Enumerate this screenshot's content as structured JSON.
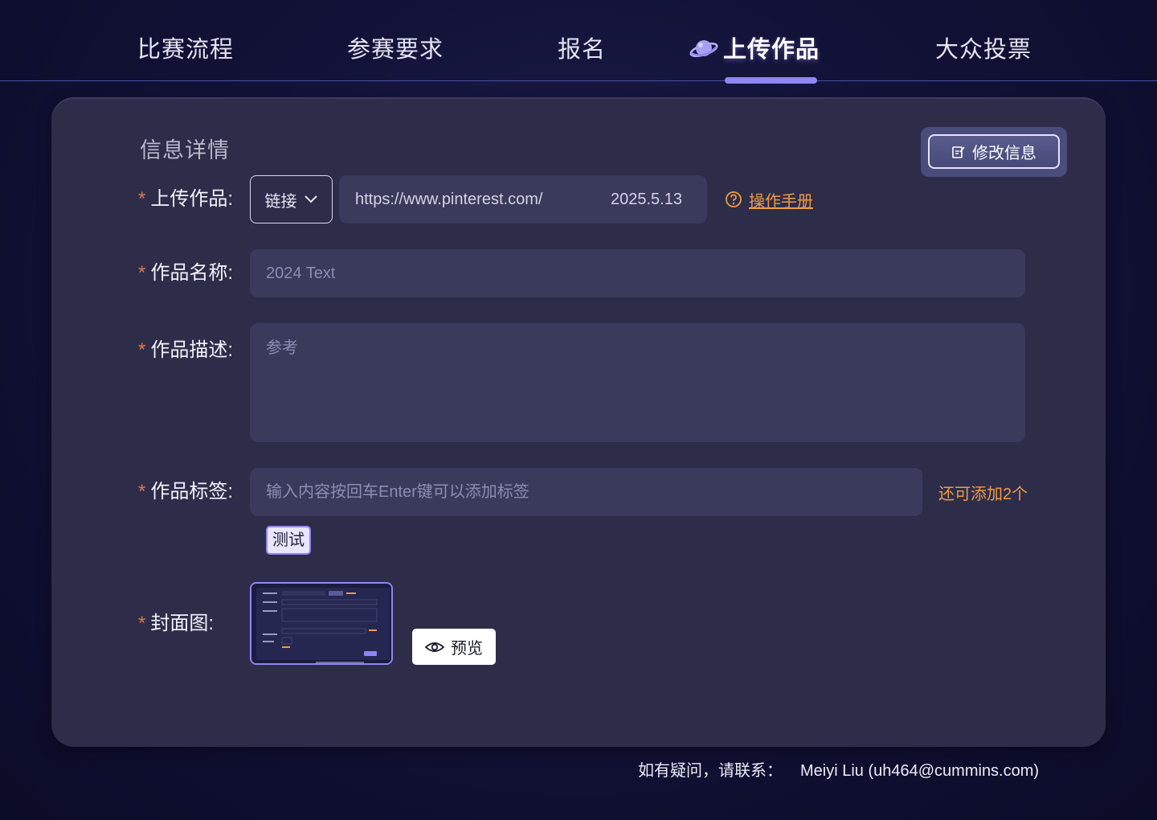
{
  "nav": {
    "tabs": [
      {
        "label": "比赛流程"
      },
      {
        "label": "参赛要求"
      },
      {
        "label": "报名"
      },
      {
        "label": "上传作品",
        "active": true,
        "icon": "planet-icon"
      },
      {
        "label": "大众投票"
      }
    ],
    "accent_color": "#8f86f3"
  },
  "form": {
    "section_title": "信息详情",
    "edit_button": {
      "label": "修改信息",
      "icon": "edit-icon"
    },
    "upload": {
      "label": "上传作品:",
      "type_select": "链接",
      "url_value": "https://www.pinterest.com/",
      "date_value": "2025.5.13",
      "manual_link": "操作手册",
      "manual_icon": "question-circle-icon"
    },
    "name": {
      "label": "作品名称:",
      "placeholder": "2024 Text"
    },
    "description": {
      "label": "作品描述:",
      "placeholder": "参考"
    },
    "tags": {
      "label": "作品标签:",
      "placeholder": "输入内容按回车Enter键可以添加标签",
      "remaining": "还可添加2个",
      "chips": [
        "测试"
      ]
    },
    "cover": {
      "label": "封面图:",
      "preview_button": "预览",
      "preview_icon": "eye-icon"
    },
    "required_mark": "*",
    "required_color": "#e0764a",
    "link_color": "#f29a45"
  },
  "footer": {
    "prompt": "如有疑问，请联系：",
    "contact": "Meiyi Liu (uh464@cummins.com)"
  }
}
